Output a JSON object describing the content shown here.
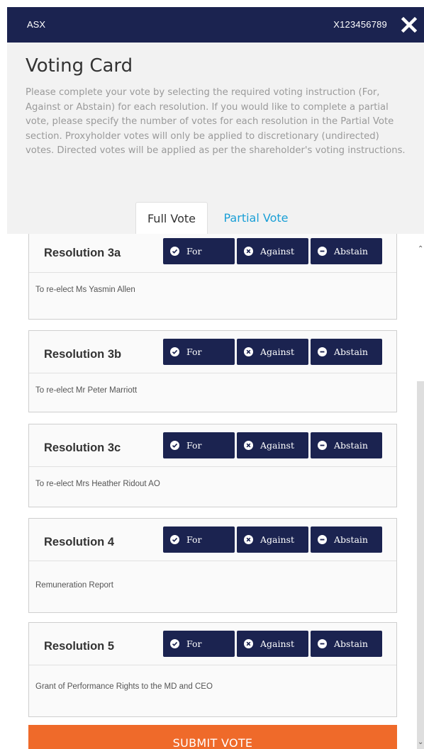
{
  "topbar": {
    "exchange": "ASX",
    "account": "X123456789",
    "close_icon": "close-icon"
  },
  "header": {
    "title": "Voting Card",
    "instructions": "Please complete your vote by selecting the required voting instruction (For, Against or Abstain) for each resolution. If you would like to complete a partial vote, please specify the number of votes for each resolution in the Partial Vote section. Proxyholder votes will only be applied to discretionary (undirected) votes. Directed votes will be applied as per the shareholder's voting instructions."
  },
  "tabs": [
    {
      "label": "Full Vote",
      "active": true
    },
    {
      "label": "Partial Vote",
      "active": false
    }
  ],
  "vote_options": {
    "for": "For",
    "against": "Against",
    "abstain": "Abstain"
  },
  "resolutions": [
    {
      "title": "Resolution 3a",
      "description": "To re-elect Ms Yasmin Allen"
    },
    {
      "title": "Resolution 3b",
      "description": "To re-elect Mr Peter Marriott"
    },
    {
      "title": "Resolution 3c",
      "description": "To re-elect Mrs Heather Ridout AO"
    },
    {
      "title": "Resolution 4",
      "description": "Remuneration Report"
    },
    {
      "title": "Resolution 5",
      "description": "Grant of Performance Rights to the MD and CEO"
    }
  ],
  "submit_label": "SUBMIT VOTE",
  "colors": {
    "navy": "#1b2350",
    "orange": "#ef6a2a",
    "link": "#1a9fd6"
  }
}
